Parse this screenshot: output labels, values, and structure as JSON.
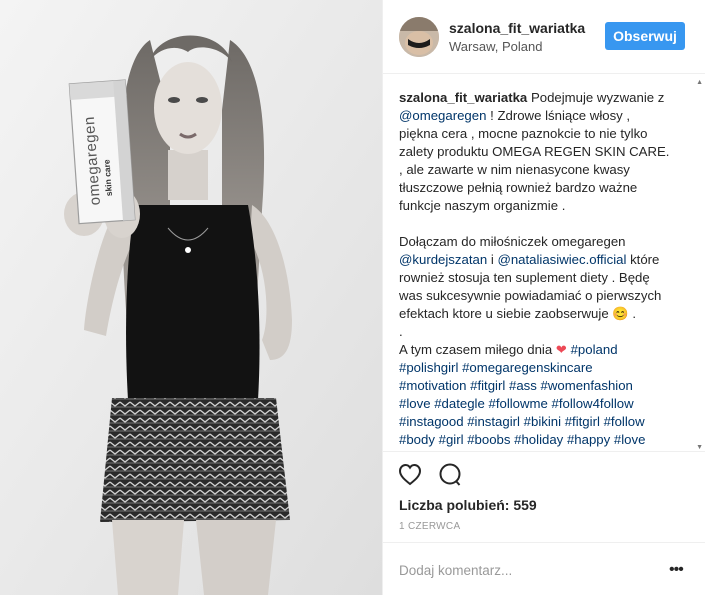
{
  "post": {
    "username": "szalona_fit_wariatka",
    "location": "Warsaw, Poland",
    "follow_label": "Obserwuj",
    "photo": {
      "box_brand": "omegaregen",
      "box_product": "skin care"
    }
  },
  "caption": {
    "lines": [
      {
        "parts": [
          {
            "text": "szalona_fit_wariatka",
            "kind": "user"
          },
          {
            "text": " Podejmuje wyzwanie z ",
            "kind": "text"
          }
        ]
      },
      {
        "parts": [
          {
            "text": "@omegaregen",
            "kind": "tag"
          },
          {
            "text": " ! Zdrowe lśniące włosy ,",
            "kind": "text"
          }
        ]
      },
      {
        "parts": [
          {
            "text": "piękna cera , mocne paznokcie to nie tylko",
            "kind": "text"
          }
        ]
      },
      {
        "parts": [
          {
            "text": "zalety produktu OMEGA REGEN SKIN CARE.",
            "kind": "text"
          }
        ]
      },
      {
        "parts": [
          {
            "text": ", ale zawarte w nim nienasycone kwasy",
            "kind": "text"
          }
        ]
      },
      {
        "parts": [
          {
            "text": "tłuszczowe pełnią rownież bardzo ważne",
            "kind": "text"
          }
        ]
      },
      {
        "parts": [
          {
            "text": "funkcje naszym organizmie .",
            "kind": "text"
          }
        ]
      },
      {
        "parts": []
      },
      {
        "parts": [
          {
            "text": "Dołączam do miłośniczek omegaregen",
            "kind": "text"
          }
        ]
      },
      {
        "parts": [
          {
            "text": "@kurdejszatan",
            "kind": "tag"
          },
          {
            "text": " i ",
            "kind": "text"
          },
          {
            "text": "@nataliasiwiec.official",
            "kind": "tag"
          },
          {
            "text": " które",
            "kind": "text"
          }
        ]
      },
      {
        "parts": [
          {
            "text": "rownież stosuja ten suplement diety . Będę",
            "kind": "text"
          }
        ]
      },
      {
        "parts": [
          {
            "text": "was sukcesywnie powiadamiać o pierwszych",
            "kind": "text"
          }
        ]
      },
      {
        "parts": [
          {
            "text": "efektach ktore u siebie zaobserwuje ",
            "kind": "text"
          },
          {
            "text": "😊",
            "kind": "emoji"
          },
          {
            "text": " .",
            "kind": "text"
          }
        ]
      },
      {
        "parts": [
          {
            "text": ".",
            "kind": "text"
          }
        ]
      },
      {
        "parts": [
          {
            "text": "A tym czasem miłego dnia ",
            "kind": "text"
          },
          {
            "text": "❤",
            "kind": "heart"
          },
          {
            "text": " ",
            "kind": "text"
          },
          {
            "text": "#poland",
            "kind": "tag"
          }
        ]
      },
      {
        "parts": [
          {
            "text": "#polishgirl",
            "kind": "tag"
          },
          {
            "text": " ",
            "kind": "text"
          },
          {
            "text": "#omegaregenskincare",
            "kind": "tag"
          }
        ]
      },
      {
        "parts": [
          {
            "text": "#motivation",
            "kind": "tag"
          },
          {
            "text": " ",
            "kind": "text"
          },
          {
            "text": "#fitgirl",
            "kind": "tag"
          },
          {
            "text": " ",
            "kind": "text"
          },
          {
            "text": "#ass",
            "kind": "tag"
          },
          {
            "text": " ",
            "kind": "text"
          },
          {
            "text": "#womenfashion",
            "kind": "tag"
          }
        ]
      },
      {
        "parts": [
          {
            "text": "#love",
            "kind": "tag"
          },
          {
            "text": " ",
            "kind": "text"
          },
          {
            "text": "#dategle",
            "kind": "tag"
          },
          {
            "text": " ",
            "kind": "text"
          },
          {
            "text": "#followme",
            "kind": "tag"
          },
          {
            "text": " ",
            "kind": "text"
          },
          {
            "text": "#follow4follow",
            "kind": "tag"
          }
        ]
      },
      {
        "parts": [
          {
            "text": "#instagood",
            "kind": "tag"
          },
          {
            "text": " ",
            "kind": "text"
          },
          {
            "text": "#instagirl",
            "kind": "tag"
          },
          {
            "text": " ",
            "kind": "text"
          },
          {
            "text": "#bikini",
            "kind": "tag"
          },
          {
            "text": " ",
            "kind": "text"
          },
          {
            "text": "#fitgirl",
            "kind": "tag"
          },
          {
            "text": " ",
            "kind": "text"
          },
          {
            "text": "#follow",
            "kind": "tag"
          }
        ]
      },
      {
        "parts": [
          {
            "text": "#body",
            "kind": "tag"
          },
          {
            "text": " ",
            "kind": "text"
          },
          {
            "text": "#girl",
            "kind": "tag"
          },
          {
            "text": " ",
            "kind": "text"
          },
          {
            "text": "#boobs",
            "kind": "tag"
          },
          {
            "text": " ",
            "kind": "text"
          },
          {
            "text": "#holiday",
            "kind": "tag"
          },
          {
            "text": " ",
            "kind": "text"
          },
          {
            "text": "#happy",
            "kind": "tag"
          },
          {
            "text": " ",
            "kind": "text"
          },
          {
            "text": "#love",
            "kind": "tag"
          }
        ]
      }
    ]
  },
  "actions": {
    "like_icon": "heart-outline-icon",
    "comment_icon": "speech-bubble-icon"
  },
  "stats": {
    "likes_text": "Liczba polubień: 559",
    "date_text": "1 CZERWCA"
  },
  "comment_box": {
    "placeholder": "Dodaj komentarz...",
    "more_label": "•••"
  },
  "colors": {
    "accent": "#3897f0",
    "link": "#003569",
    "heart": "#ed4956"
  }
}
